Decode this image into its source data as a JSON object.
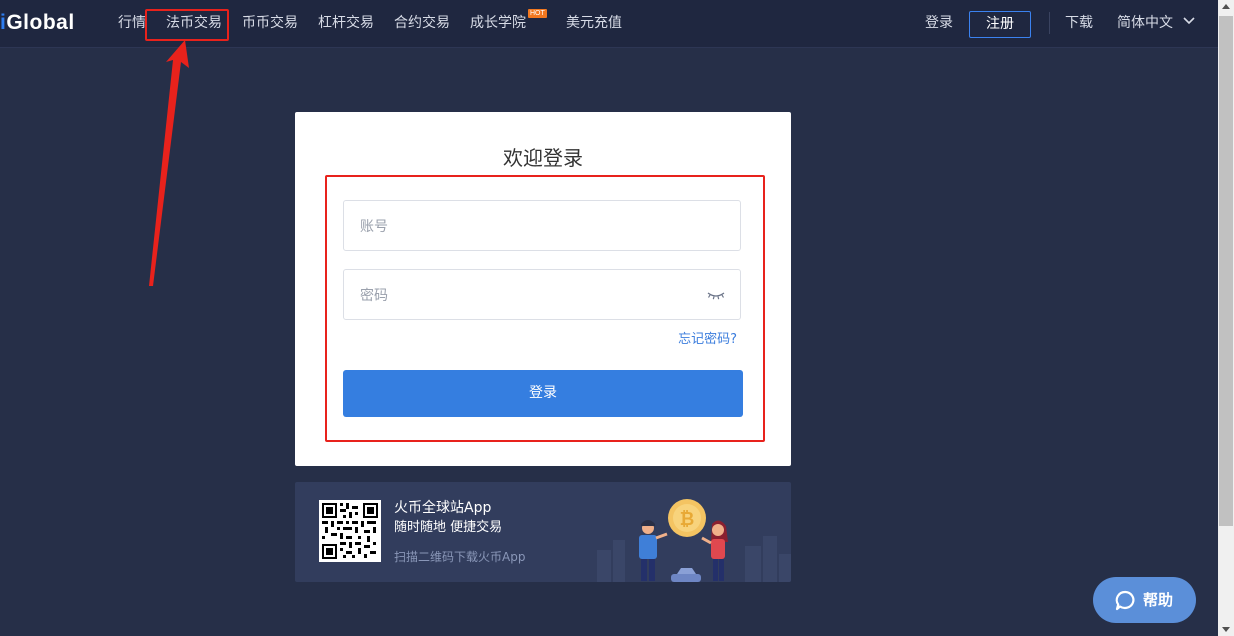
{
  "header": {
    "logo_prefix": "i",
    "logo_text": "Global",
    "nav": [
      "行情",
      "法币交易",
      "币币交易",
      "杠杆交易",
      "合约交易",
      "成长学院",
      "美元充值"
    ],
    "hot_badge": "HOT",
    "login": "登录",
    "register": "注册",
    "download": "下载",
    "language": "简体中文"
  },
  "login_card": {
    "title": "欢迎登录",
    "account_placeholder": "账号",
    "password_placeholder": "密码",
    "forgot_password": "忘记密码?",
    "submit": "登录"
  },
  "app_banner": {
    "title": "火币全球站App",
    "subtitle": "随时随地 便捷交易",
    "scan_text": "扫描二维码下载火币App"
  },
  "help": {
    "label": "帮助"
  },
  "colors": {
    "background": "#262f48",
    "header": "#1f2740",
    "accent": "#357ee0",
    "highlight": "#e8221c",
    "hot": "#f27820"
  },
  "icons": [
    "eye-closed-icon",
    "chevron-down-icon",
    "chat-bubble-icon",
    "qr-code",
    "bitcoin-coin"
  ]
}
